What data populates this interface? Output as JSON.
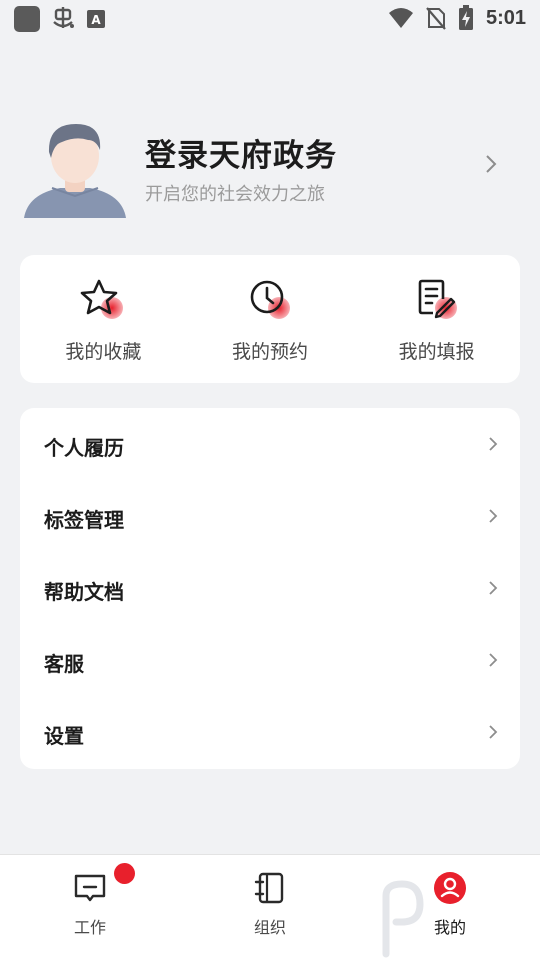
{
  "status_bar": {
    "time": "5:01",
    "left_icons": [
      "app-square-icon",
      "bug-icon",
      "keyboard-a-icon"
    ],
    "right_icons": [
      "wifi-icon",
      "no-sim-icon",
      "battery-charging-icon"
    ]
  },
  "profile": {
    "title": "登录天府政务",
    "subtitle": "开启您的社会效力之旅"
  },
  "quick_actions": [
    {
      "label": "我的收藏",
      "icon": "star-icon"
    },
    {
      "label": "我的预约",
      "icon": "clock-icon"
    },
    {
      "label": "我的填报",
      "icon": "form-edit-icon"
    }
  ],
  "menu": [
    {
      "label": "个人履历"
    },
    {
      "label": "标签管理"
    },
    {
      "label": "帮助文档"
    },
    {
      "label": "客服"
    },
    {
      "label": "设置"
    }
  ],
  "tabs": [
    {
      "label": "工作",
      "icon": "message-screen-icon",
      "has_badge": true
    },
    {
      "label": "组织",
      "icon": "notebook-icon",
      "has_badge": false
    },
    {
      "label": "我的",
      "icon": "user-circle-icon",
      "active": true
    }
  ],
  "colors": {
    "accent": "#e8202c",
    "background": "#f1f2f4",
    "card": "#ffffff"
  }
}
